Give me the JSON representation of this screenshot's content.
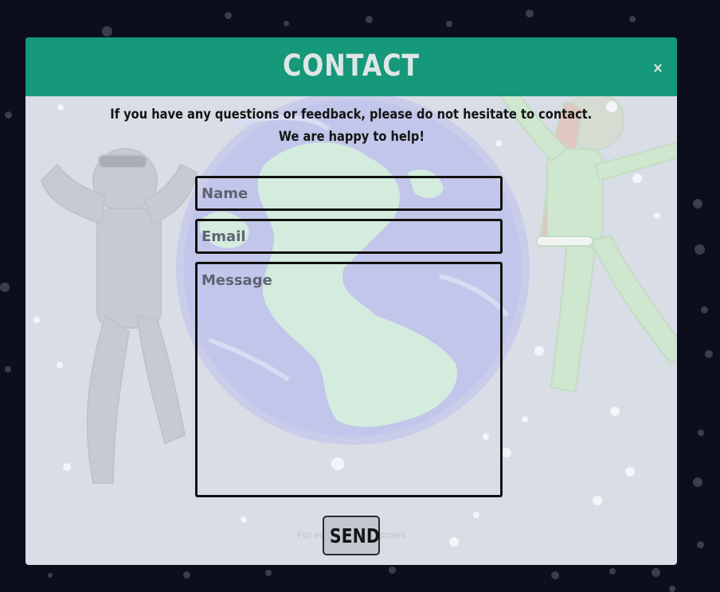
{
  "modal": {
    "title": "CONTACT",
    "close_label": "×",
    "intro_line1": "If you have any questions or feedback, please do not hesitate to contact.",
    "intro_line2": "We are happy to help!",
    "footer_note": "For educational purposes"
  },
  "form": {
    "name_placeholder": "Name",
    "name_value": "",
    "email_placeholder": "Email",
    "email_value": "",
    "message_placeholder": "Message",
    "message_value": "",
    "send_label": "SEND"
  },
  "colors": {
    "header": "#16987a",
    "modal_bg": "#d9dde6",
    "page_bg": "#0c0e1c"
  },
  "icons": {
    "close": "close-icon"
  }
}
